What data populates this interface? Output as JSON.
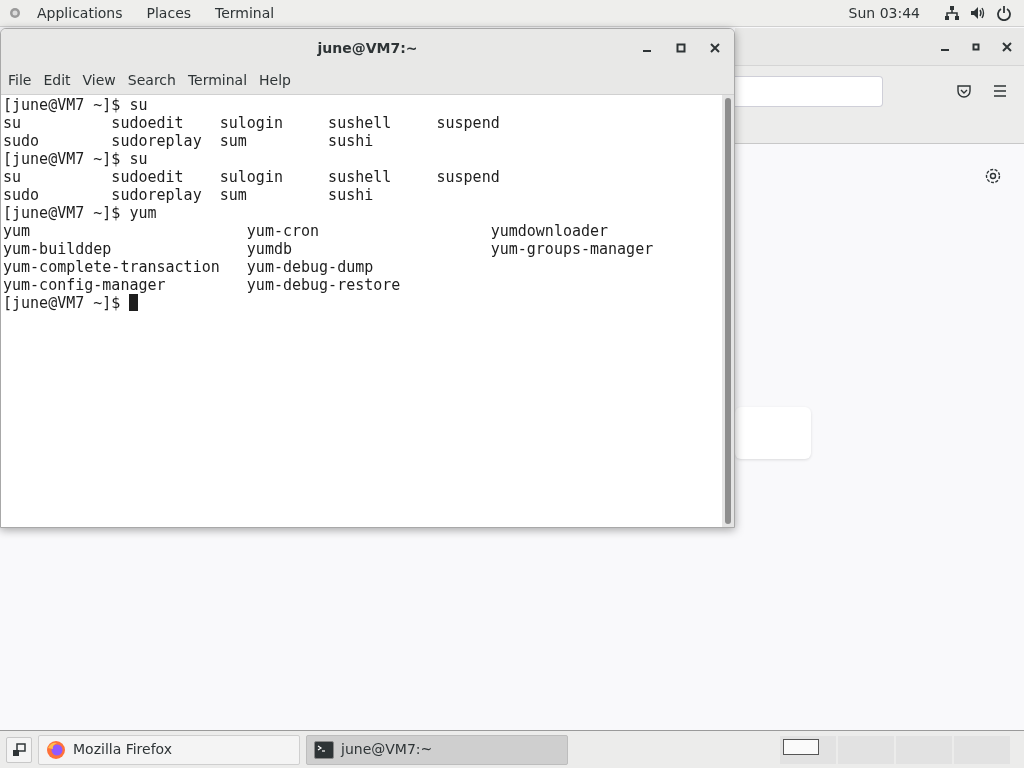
{
  "top_bar": {
    "menus": [
      "Applications",
      "Places",
      "Terminal"
    ],
    "clock": "Sun 03:44"
  },
  "terminal": {
    "title": "june@VM7:~",
    "menu": [
      "File",
      "Edit",
      "View",
      "Search",
      "Terminal",
      "Help"
    ],
    "lines": [
      "[june@VM7 ~]$ su",
      "su          sudoedit    sulogin     sushell     suspend",
      "sudo        sudoreplay  sum         sushi",
      "[june@VM7 ~]$ su",
      "su          sudoedit    sulogin     sushell     suspend",
      "sudo        sudoreplay  sum         sushi",
      "[june@VM7 ~]$ yum",
      "yum                        yum-cron                   yumdownloader",
      "yum-builddep               yumdb                      yum-groups-manager",
      "yum-complete-transaction   yum-debug-dump",
      "yum-config-manager         yum-debug-restore",
      "[june@VM7 ~]$ "
    ]
  },
  "taskbar": {
    "items": [
      {
        "label": "Mozilla Firefox",
        "kind": "firefox",
        "selected": false
      },
      {
        "label": "june@VM7:~",
        "kind": "terminal",
        "selected": true
      }
    ],
    "workspaces": [
      {
        "selected": true
      },
      {
        "selected": false
      },
      {
        "selected": false
      },
      {
        "selected": false
      }
    ]
  }
}
